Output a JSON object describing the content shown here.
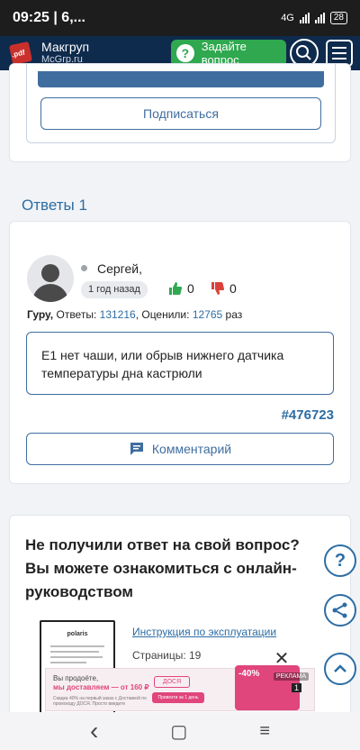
{
  "status_bar": {
    "time": "09:25 | 6,...",
    "network": "4G",
    "battery": "28"
  },
  "header": {
    "brand_name": "Макгруп",
    "brand_domain": "McGrp.ru",
    "logo_text": ".pdf",
    "ask_button": "Задайте вопрос"
  },
  "subscribe": {
    "button_label": "Подписаться"
  },
  "answers": {
    "title": "Ответы 1",
    "items": [
      {
        "author": "Сергей,",
        "time_ago": "1 год назад",
        "likes": "0",
        "dislikes": "0",
        "rank": "Гуру,",
        "answers_label": "Ответы:",
        "answers_count": "131216",
        "ratings_label": ", Оценили:",
        "ratings_count": "12765",
        "times_label": "раз",
        "text": "Е1 нет чаши, или обрыв нижнего датчика температуры дна кастрюли",
        "id": "#476723",
        "comment_button": "Комментарий"
      }
    ]
  },
  "manual_cta": {
    "title": "Не получили ответ на свой вопрос? Вы можете ознакомиться с онлайн-руководством",
    "link": "Инструкция по эксплуатации",
    "pages": "Страницы: 19",
    "thumb_brand": "polaris"
  },
  "fabs": {
    "help": "?",
    "share": "share-icon",
    "up": "chevron-up-icon"
  },
  "ad": {
    "line1": "Вы продоёте,",
    "line2": "мы доставляем — от 160 ₽",
    "fine": "Скидка 40% на первый заказ с Доставкой по промокоду ДОСЯ. Просто введите",
    "brand": "ДОСЯ",
    "button": "Привезти за 1 день",
    "banner_text": "-40%",
    "label": "РЕКЛАМА",
    "counter": "1",
    "close": "✕"
  },
  "nav": {
    "back": "‹",
    "home": "▢",
    "menu": "≡"
  },
  "colors": {
    "header_bg": "#0e2a4c",
    "accent_blue": "#2c6da4",
    "ask_green": "#2fa84f",
    "like_green": "#2fa84f",
    "dislike_red": "#d9423b"
  }
}
